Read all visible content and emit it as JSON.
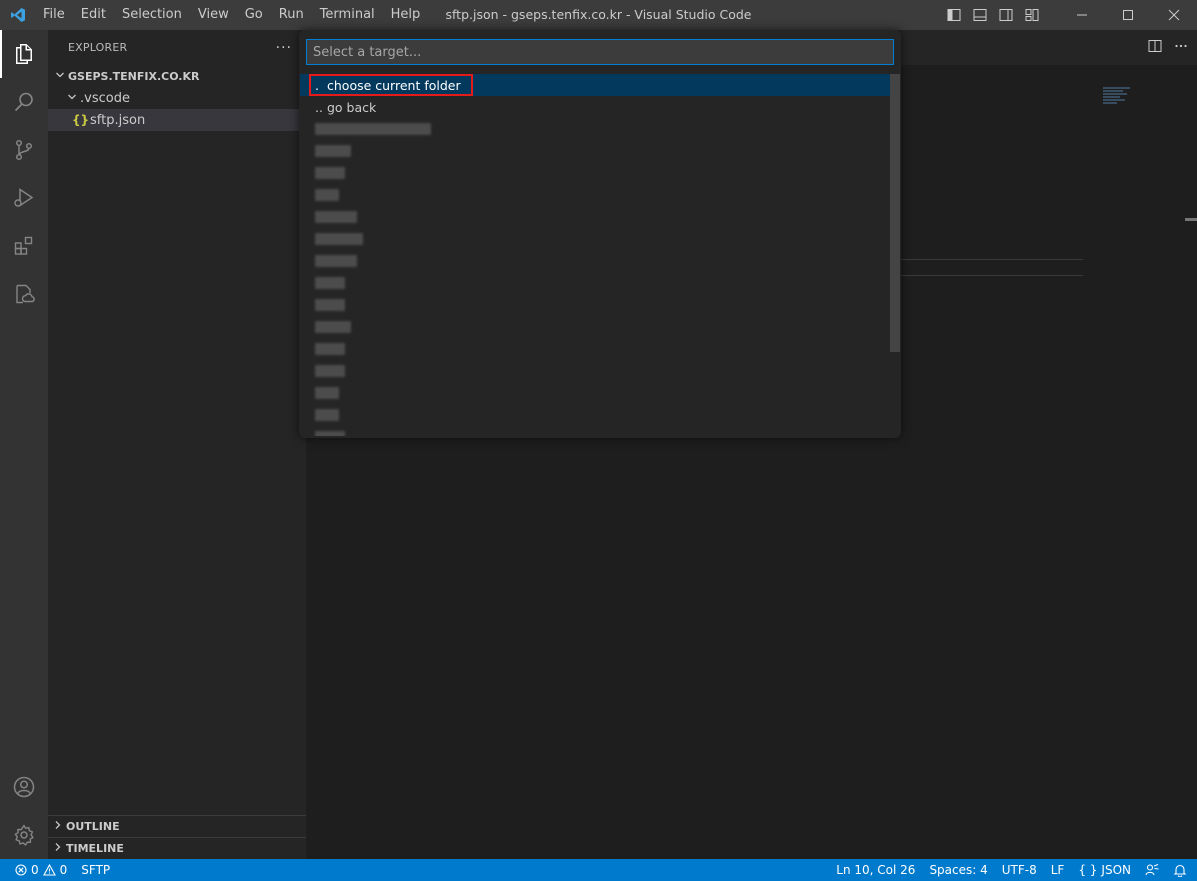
{
  "window": {
    "title": "sftp.json - gseps.tenfix.co.kr - Visual Studio Code",
    "menu": [
      "File",
      "Edit",
      "Selection",
      "View",
      "Go",
      "Run",
      "Terminal",
      "Help"
    ]
  },
  "activity_bar": {
    "items": [
      "files-icon",
      "search-icon",
      "source-control-icon",
      "run-debug-icon",
      "extensions-icon",
      "remote-explorer-icon"
    ],
    "bottom": [
      "account-icon",
      "manage-gear-icon"
    ]
  },
  "sidebar": {
    "title": "EXPLORER",
    "more": "···",
    "root": "GSEPS.TENFIX.CO.KR",
    "folder": ".vscode",
    "file": "sftp.json",
    "file_icon": "{}",
    "sections": [
      "OUTLINE",
      "TIMELINE"
    ]
  },
  "quick_pick": {
    "placeholder": "Select a target...",
    "items": [
      {
        "prefix": ".",
        "label": "choose current folder"
      },
      {
        "prefix": "..",
        "label": "go back"
      }
    ],
    "redacted_widths": [
      116,
      36,
      30,
      24,
      42,
      48,
      42,
      30,
      30,
      36,
      30,
      30,
      24,
      24,
      30
    ]
  },
  "status_bar": {
    "errors": "0",
    "warnings": "0",
    "sftp": "SFTP",
    "position": "Ln 10, Col 26",
    "spaces": "Spaces: 4",
    "encoding": "UTF-8",
    "eol": "LF",
    "language": "JSON",
    "language_icon": "{ }"
  },
  "colors": {
    "accent": "#007acc",
    "focus_border": "#007fd4",
    "highlight_box": "#e51a1a",
    "list_focus": "#04395e"
  }
}
